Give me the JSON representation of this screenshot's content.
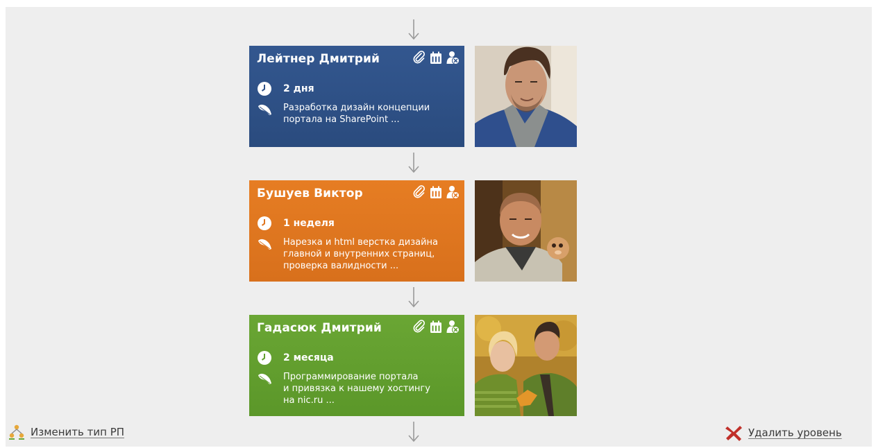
{
  "cards": [
    {
      "name": "Лейтнер Дмитрий",
      "duration": "2 дня",
      "description_line1": "Разработка дизайн концепции",
      "description_line2": "портала на SharePoint ...",
      "description_line3": "",
      "color": "#2e5087"
    },
    {
      "name": "Бушуев Виктор",
      "duration": "1 неделя",
      "description_line1": "Нарезка и html верстка дизайна",
      "description_line2": "главной и внутренних страниц,",
      "description_line3": "проверка валидности ...",
      "color": "#e07620"
    },
    {
      "name": "Гадасюк Дмитрий",
      "duration": "2 месяца",
      "description_line1": "Программирование портала",
      "description_line2": "и привязка к нашему хостингу",
      "description_line3": "на nic.ru ...",
      "color": "#62a02f"
    }
  ],
  "card_actions": [
    "paperclip-icon",
    "calendar-icon",
    "remove-user-icon"
  ],
  "footer": {
    "change_type_label": "Изменить тип РП",
    "delete_level_label": "Удалить уровень"
  },
  "colors": {
    "background": "#eeeeee",
    "delete_icon": "#c0302a",
    "change_icon": "#e7a83a"
  }
}
